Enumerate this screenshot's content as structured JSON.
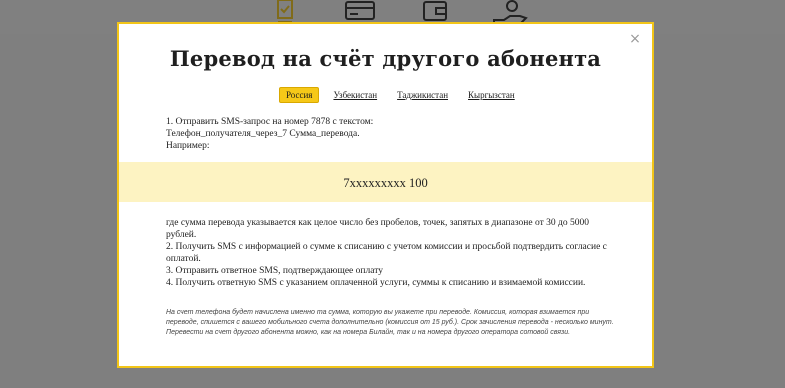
{
  "background": {
    "icons": [
      "checklist-icon",
      "card-icon",
      "wallet-icon",
      "hand-coin-icon"
    ]
  },
  "modal": {
    "title": "Перевод на счёт другого абонента",
    "close_symbol": "×",
    "tabs": [
      {
        "label": "Россия",
        "active": true
      },
      {
        "label": "Узбекистан",
        "active": false
      },
      {
        "label": "Таджикистан",
        "active": false
      },
      {
        "label": "Кыргызстан",
        "active": false
      }
    ],
    "intro": {
      "line1": "1. Отправить SMS-запрос на номер 7878 с текстом:",
      "line2": "Телефон_получателя_через_7 Сумма_перевода.",
      "line3": "Например:"
    },
    "example": "7xxxxxxxxx 100",
    "steps": {
      "s1": "где сумма перевода указывается как целое число без пробелов, точек, запятых в диапазоне от 30 до 5000 рублей.",
      "s2": "2. Получить SMS с информацией о сумме к списанию с учетом комиссии и просьбой подтвердить согласие с оплатой.",
      "s3": "3. Отправить ответное SMS, подтверждающее оплату",
      "s4": "4. Получить ответную SMS с указанием оплаченной услуги, суммы к списанию и взимаемой комиссии."
    },
    "note": "На счет телефона будет начислена именно та сумма, которую вы укажете при переводе. Комиссия, которая взимается при переводе, спишется с вашего мобильного счета дополнительно (комиссия от 15 руб.). Срок зачисления перевода - несколько минут. Перевести на счет другого абонента можно, как на номера Билайн, так и на номера другого оператора сотовой связи."
  },
  "colors": {
    "accent": "#f6c818",
    "example_band": "#fdf3c2",
    "overlay": "#7f7f7f"
  }
}
